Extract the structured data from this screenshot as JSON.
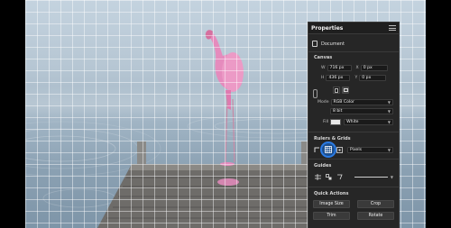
{
  "panel": {
    "title": "Properties",
    "document_label": "Document",
    "canvas": {
      "section_title": "Canvas",
      "width_label": "W",
      "width_value": "716 px",
      "height_label": "H",
      "height_value": "436 px",
      "x_label": "X",
      "x_value": "0 px",
      "y_label": "Y",
      "y_value": "0 px",
      "mode_label": "Mode",
      "mode_value": "RGB Color",
      "bit_depth_value": "8 bit",
      "fill_label": "Fill",
      "fill_value": "White"
    },
    "rulers_grids": {
      "section_title": "Rulers & Grids",
      "units_value": "Pixels"
    },
    "guides": {
      "section_title": "Guides"
    },
    "quick_actions": {
      "section_title": "Quick Actions",
      "buttons": [
        "Image Size",
        "Crop",
        "Trim",
        "Rotate"
      ]
    }
  },
  "colors": {
    "panel_bg": "#262626",
    "highlight": "#2b7be4",
    "flamingo": "#e58bbd"
  },
  "icons": {
    "menu": "panel-menu-icon",
    "document": "document-icon",
    "link": "link-icon",
    "portrait": "portrait-orientation-icon",
    "landscape": "landscape-orientation-icon",
    "ruler": "ruler-icon",
    "grid": "grid-icon",
    "pixel_grid": "pixel-grid-icon",
    "guides": "guides-icon"
  }
}
